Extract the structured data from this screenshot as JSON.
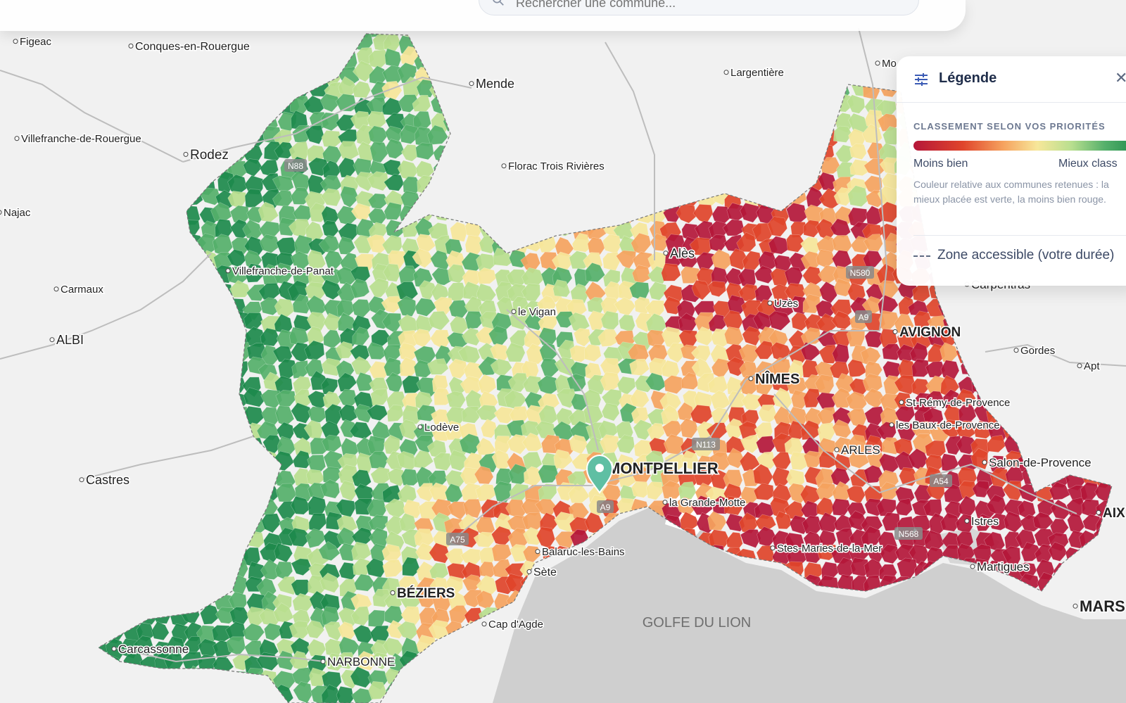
{
  "search": {
    "placeholder": "Rechercher une commune..."
  },
  "legend": {
    "title": "Légende",
    "section_title": "CLASSEMENT SELON VOS PRIORITÉS",
    "low_label": "Moins bien",
    "high_label": "Mieux class",
    "description": "Couleur relative aux communes retenues : la mieux placée est verte, la moins bien rouge.",
    "zone_label": "Zone accessible (votre durée)",
    "scale_colors": [
      "#b5173a",
      "#e0452b",
      "#f6a35f",
      "#f7e79a",
      "#b9df8f",
      "#55b06b",
      "#1e8a4c"
    ]
  },
  "map": {
    "sea_label": "GOLFE DU LION",
    "cities": [
      {
        "name": "Figeac"
      },
      {
        "name": "Conques-en-Rouergue"
      },
      {
        "name": "Mende"
      },
      {
        "name": "Largentière"
      },
      {
        "name": "Villefranche-de-Rouergue"
      },
      {
        "name": "Rodez"
      },
      {
        "name": "Florac Trois Rivières"
      },
      {
        "name": "Najac"
      },
      {
        "name": "Villefranche-de-Panat"
      },
      {
        "name": "Alès"
      },
      {
        "name": "Carmaux"
      },
      {
        "name": "le Vigan"
      },
      {
        "name": "Uzès"
      },
      {
        "name": "Carpentras"
      },
      {
        "name": "ALBI"
      },
      {
        "name": "AVIGNON"
      },
      {
        "name": "Gordes"
      },
      {
        "name": "Apt"
      },
      {
        "name": "NÎMES"
      },
      {
        "name": "St-Rémy-de-Provence"
      },
      {
        "name": "Lodève"
      },
      {
        "name": "les Baux-de-Provence"
      },
      {
        "name": "ARLES"
      },
      {
        "name": "Castres"
      },
      {
        "name": "MONTPELLIER"
      },
      {
        "name": "Salon-de-Provence"
      },
      {
        "name": "la Grande-Motte"
      },
      {
        "name": "AIX"
      },
      {
        "name": "Istres"
      },
      {
        "name": "Stes-Maries-de-la-Mer"
      },
      {
        "name": "Balaruc-les-Bains"
      },
      {
        "name": "Martigues"
      },
      {
        "name": "Sète"
      },
      {
        "name": "BÉZIERS"
      },
      {
        "name": "MARS"
      },
      {
        "name": "Cap d'Agde"
      },
      {
        "name": "Carcassonne"
      },
      {
        "name": "NARBONNE"
      },
      {
        "name": "Mo"
      }
    ],
    "road_shields": [
      "N88",
      "N580",
      "A9",
      "N113",
      "A54",
      "A9",
      "A75",
      "N568"
    ]
  }
}
